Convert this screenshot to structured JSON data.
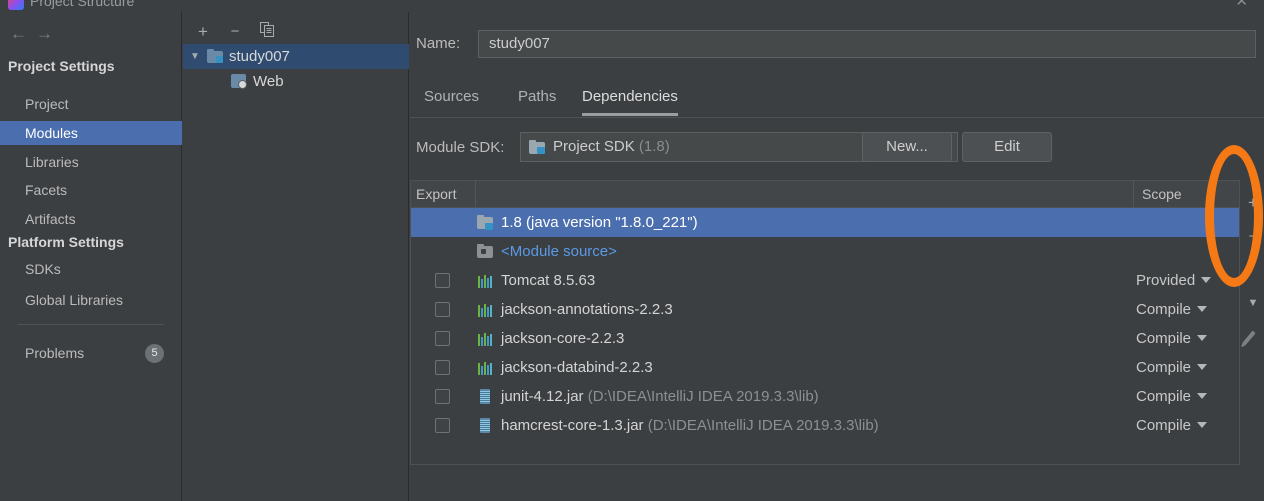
{
  "window": {
    "title": "Project Structure",
    "close_label": "✕"
  },
  "nav": {
    "back": "←",
    "forward": "→"
  },
  "sidebar": {
    "groups": [
      {
        "title": "Project Settings",
        "items": [
          {
            "label": "Project",
            "selected": false
          },
          {
            "label": "Modules",
            "selected": true
          },
          {
            "label": "Libraries",
            "selected": false
          },
          {
            "label": "Facets",
            "selected": false
          },
          {
            "label": "Artifacts",
            "selected": false
          }
        ]
      },
      {
        "title": "Platform Settings",
        "items": [
          {
            "label": "SDKs",
            "selected": false
          },
          {
            "label": "Global Libraries",
            "selected": false
          }
        ]
      }
    ],
    "problems": {
      "label": "Problems",
      "count": "5"
    }
  },
  "tree_toolbar": {
    "add": "+",
    "remove": "−",
    "copy": "copy-icon"
  },
  "module_tree": [
    {
      "label": "study007",
      "selected": true,
      "icon": "module-folder-icon",
      "depth": 0,
      "expanded": true
    },
    {
      "label": "Web",
      "selected": false,
      "icon": "web-facet-icon",
      "depth": 1,
      "expanded": false
    }
  ],
  "detail": {
    "name": {
      "label": "Name:",
      "value": "study007"
    },
    "tabs": [
      {
        "label": "Sources",
        "active": false
      },
      {
        "label": "Paths",
        "active": false
      },
      {
        "label": "Dependencies",
        "active": true
      }
    ],
    "sdk": {
      "label": "Module SDK:",
      "value": "Project SDK",
      "value_suffix": "(1.8)",
      "new_button": "New...",
      "edit_button": "Edit"
    },
    "table": {
      "headers": {
        "export": "Export",
        "scope": "Scope"
      },
      "rows": [
        {
          "name": "1.8 (java version \"1.8.0_221\")",
          "path": "",
          "scope": "",
          "icon": "sdk-icon",
          "checkbox": false,
          "selected": true,
          "link": false
        },
        {
          "name": "<Module source>",
          "path": "",
          "scope": "",
          "icon": "module-source-icon",
          "checkbox": false,
          "selected": false,
          "link": true
        },
        {
          "name": "Tomcat 8.5.63",
          "path": "",
          "scope": "Provided",
          "icon": "library-icon",
          "checkbox": true,
          "selected": false,
          "link": false
        },
        {
          "name": "jackson-annotations-2.2.3",
          "path": "",
          "scope": "Compile",
          "icon": "library-icon",
          "checkbox": true,
          "selected": false,
          "link": false
        },
        {
          "name": "jackson-core-2.2.3",
          "path": "",
          "scope": "Compile",
          "icon": "library-icon",
          "checkbox": true,
          "selected": false,
          "link": false
        },
        {
          "name": "jackson-databind-2.2.3",
          "path": "",
          "scope": "Compile",
          "icon": "library-icon",
          "checkbox": true,
          "selected": false,
          "link": false
        },
        {
          "name": "junit-4.12.jar",
          "path": "(D:\\IDEA\\IntelliJ IDEA 2019.3.3\\lib)",
          "scope": "Compile",
          "icon": "jar-icon",
          "checkbox": true,
          "selected": false,
          "link": false
        },
        {
          "name": "hamcrest-core-1.3.jar",
          "path": "(D:\\IDEA\\IntelliJ IDEA 2019.3.3\\lib)",
          "scope": "Compile",
          "icon": "jar-icon",
          "checkbox": true,
          "selected": false,
          "link": false
        }
      ]
    },
    "dep_toolbar": {
      "add": "+",
      "remove": "−",
      "move_down": "▼",
      "edit": "pencil-icon"
    }
  },
  "annotation": {
    "shape": "ellipse-highlight",
    "color": "#f57a16",
    "target": "add-dependency-button"
  },
  "colors": {
    "background": "#3c3f41",
    "selection_blue": "#4b6eaf",
    "tree_selection": "#2f4c70",
    "link_blue": "#5a9ae8",
    "annotation_orange": "#f57a16",
    "text": "#bbbbbb"
  }
}
